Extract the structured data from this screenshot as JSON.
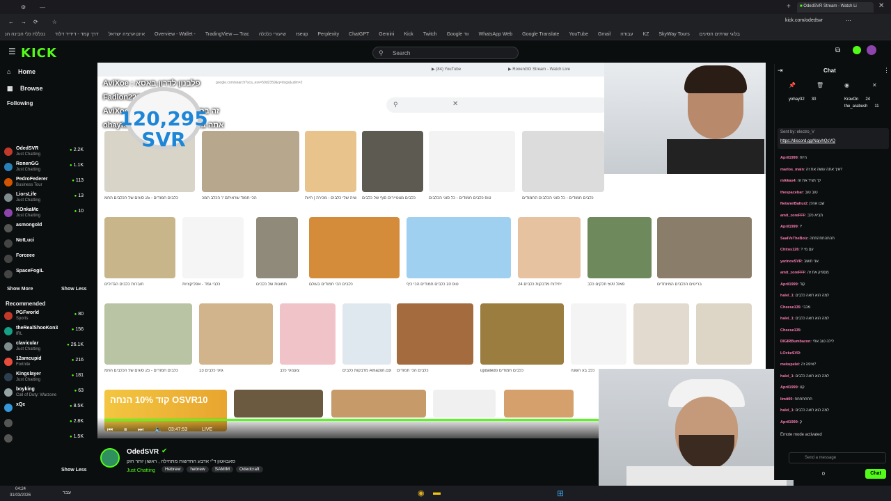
{
  "browser": {
    "active_tab": "OdedSVR Stream - Watch Li",
    "url": "kick.com/odedsvr",
    "bookmarks": [
      "נכללת כלי הבינה הנ",
      "דרך קמד - דידיד דלוד",
      "אינטיגרציה ישראל",
      "Overview - Wallet -",
      "TradingView — Trac",
      "שיעורי כלכלה",
      "rseup",
      "Perplexity",
      "ChatGPT",
      "Gemini",
      "Kick",
      "Twitch",
      "Google ווד",
      "WhatsApp Web",
      "Google Translate",
      "YouTube",
      "Gmail",
      "עבודה",
      "KZ",
      "SkyWay Tours",
      "בלוגי שרתים הסינים"
    ]
  },
  "header": {
    "logo": "KICK",
    "search_placeholder": "Search"
  },
  "sidebar": {
    "home": "Home",
    "browse": "Browse",
    "following": "Following",
    "following_channels": [
      {
        "name": "OdedSVR",
        "cat": "Just Chatting",
        "count": "2.2K",
        "color": "#c0392b"
      },
      {
        "name": "RonenGG",
        "cat": "Just Chatting",
        "count": "1.1K",
        "color": "#2980b9"
      },
      {
        "name": "PedroFederer",
        "cat": "Business Tour",
        "count": "113",
        "color": "#d35400"
      },
      {
        "name": "LiorsLife",
        "cat": "Just Chatting",
        "count": "13",
        "color": "#7f8c8d"
      },
      {
        "name": "KOnkaMc",
        "cat": "Just Chatting",
        "count": "10",
        "color": "#8e44ad"
      },
      {
        "name": "asmongold",
        "cat": "",
        "count": "",
        "color": "#555"
      },
      {
        "name": "NotLuci",
        "cat": "",
        "count": "",
        "color": "#444"
      },
      {
        "name": "Forceee",
        "cat": "",
        "count": "",
        "color": "#444"
      },
      {
        "name": "SpaceFogIL",
        "cat": "",
        "count": "",
        "color": "#444"
      }
    ],
    "show_more": "Show More",
    "show_less": "Show Less",
    "recommended": "Recommended",
    "recommended_channels": [
      {
        "name": "PGFworld",
        "cat": "Sports",
        "count": "80",
        "color": "#c0392b"
      },
      {
        "name": "theRealShooKon3",
        "cat": "IRL",
        "count": "156",
        "color": "#16a085"
      },
      {
        "name": "clavicular",
        "cat": "Just Chatting",
        "count": "26.1K",
        "color": "#7f8c8d"
      },
      {
        "name": "12amcupid",
        "cat": "Fortnite",
        "count": "216",
        "color": "#e74c3c"
      },
      {
        "name": "Kingslayer",
        "cat": "Just Chatting",
        "count": "181",
        "color": "#2c3e50"
      },
      {
        "name": "boyking",
        "cat": "Call of Duty: Warzone",
        "count": "63",
        "color": "#95a5a6"
      },
      {
        "name": "xQc",
        "cat": "",
        "count": "8.5K",
        "color": "#3498db"
      },
      {
        "name": "",
        "cat": "",
        "count": "2.8K",
        "color": "#555"
      },
      {
        "name": "",
        "cat": "",
        "count": "1.5K",
        "color": "#555"
      }
    ]
  },
  "overlay": {
    "top_chat": [
      "AviXoe : פלבנון לדרון באסא",
      "Fadlon2203 : קוד עליך",
      "AviXoe : זה בסבלו את אוהב אותך",
      "ohaytshouva : אתה באמת לא יודע"
    ],
    "banner_text": "120,295 SVR",
    "promo": "קוד 10% הנחה OSVR10",
    "time": "03:47:53",
    "live": "LIVE"
  },
  "images": [
    {
      "cap": "כלבים חמודים - 25 סוגים של הכלבים החמ"
    },
    {
      "cap": "הכי חמוד שראיתם ? הכלב המכ"
    },
    {
      "cap": "שיה שלי כלבים - מכירה | חיות"
    },
    {
      "cap": "כלבים מצטיירים סוף של כלבים"
    },
    {
      "cap": "טופ כלבים חמודים - כל סוגי הכלבים"
    },
    {
      "cap": "כלבים חמודים - כל סוגי הכלבים החמודים"
    },
    {
      "cap": "חוברות כלבים הגדולים"
    },
    {
      "cap": "כלבי גמד - אפליקציות"
    },
    {
      "cap": "תמונות של כלבים"
    },
    {
      "cap": "כלבים הכי חמודים בעולם"
    },
    {
      "cap": "טופ 10 כלבים חמודים הכי כיף"
    },
    {
      "cap": "24 יחידות מדבקות כלבים"
    },
    {
      "cap": "פאזל 500 חלקים כלב"
    },
    {
      "cap": "בריטים הכלבים המיוחדים"
    },
    {
      "cap": "כלבים חמודים - 25 סוגים של הכלבים החמ"
    },
    {
      "cap": "13 גזעי כלבים"
    },
    {
      "cap": "צעצועי כלב"
    },
    {
      "cap": "מדבקות כלבים Amazon.com"
    },
    {
      "cap": "כלבים הכי חמודים"
    },
    {
      "cap": "updatedo כלבים חמודים"
    },
    {
      "cap": "כלב בע השנה"
    },
    {
      "cap": "מדבקות 6 סוגים"
    },
    {
      "cap": "כלבים חמודים"
    }
  ],
  "streamer": {
    "name": "OdedSVR",
    "title": "סאבאטון ד\"י אדבע החדשות מתחילה , ראשון יותר חוק",
    "category": "Just Chatting",
    "tags": [
      "Hebrew",
      "hebrew",
      "SAMIM",
      "Odedcraft"
    ]
  },
  "chat": {
    "title": "Chat",
    "pinned_users": [
      {
        "name": "yohay32",
        "count": "30"
      },
      {
        "name": "KravOn",
        "count": "24"
      },
      {
        "name": "the_arabush",
        "count": "11"
      }
    ],
    "sent_by": "Sent by: electro_V",
    "discord_link": "https://discord.gg/NajvhQcVQ",
    "messages": [
      {
        "user": "April1999",
        "text": ": היזח"
      },
      {
        "user": "marlos_main",
        "text": ": איך אתה עושה את זה?"
      },
      {
        "user": "mikkas4",
        "text": ": לך תגיד את זה"
      },
      {
        "user": "thespacebar",
        "text": ": טוב טוב"
      },
      {
        "user": "NetanelBahur2",
        "text": ": שבו אהלן"
      },
      {
        "user": "amit_zoreFFF",
        "text": ": תביא כלב"
      },
      {
        "user": "April1999",
        "text": ": ?"
      },
      {
        "user": "SaalVeTheBolz",
        "text": ": חהחהחחהחחה"
      },
      {
        "user": "Chitos126",
        "text": ": ? עם מי"
      },
      {
        "user": "yarinovSVR",
        "text": ": אני חושב"
      },
      {
        "user": "amit_zoreFFF",
        "text": ": מספיק את זה"
      },
      {
        "user": "April1999",
        "text": ": קוד"
      },
      {
        "user": "halel_1",
        "text": ": למה הוא רואה כלבים"
      },
      {
        "user": "Cheese135",
        "text": ": מכבי"
      },
      {
        "user": "halel_1",
        "text": ": למה הוא רואה כלבים"
      },
      {
        "user": "Cheese135",
        "text": ": "
      },
      {
        "user": "DIGIRBumbazon",
        "text": ": לילה טוב אחי"
      },
      {
        "user": "LOckeSVR",
        "text": ": "
      },
      {
        "user": "mekupelel",
        "text": ": איפה זה?"
      },
      {
        "user": "halel_1",
        "text": ": למה הוא רואה כלבים"
      },
      {
        "user": "April1999",
        "text": ": קט"
      },
      {
        "user": "limit00",
        "text": ": חחחחחחח"
      },
      {
        "user": "halel_1",
        "text": ": למה הוא רואה כלבים"
      },
      {
        "user": "April1999",
        "text": ": ק"
      }
    ],
    "mode": "Emote mode activated",
    "input_placeholder": "Send a message",
    "send_label": "Chat",
    "points": "0"
  },
  "taskbar": {
    "time": "04:24",
    "date": "31/03/2026",
    "lang": "עבר"
  }
}
